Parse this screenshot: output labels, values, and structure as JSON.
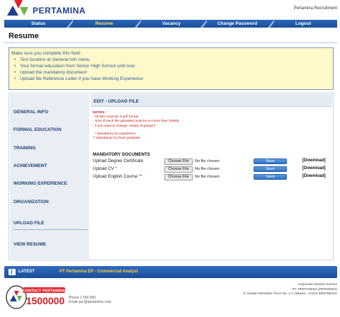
{
  "header": {
    "logo_text": "PERTAMINA",
    "recruitment_label": "Pertamina Recruitment",
    "colors": {
      "brand_blue": "#1e3f8a",
      "brand_red": "#e12229",
      "brand_green": "#6bb644"
    }
  },
  "nav": {
    "items": [
      {
        "label": "Status"
      },
      {
        "label": "Resume"
      },
      {
        "label": "Vacancy"
      },
      {
        "label": "Change Password"
      },
      {
        "label": "Logout"
      }
    ],
    "active": "Resume"
  },
  "page": {
    "title": "Resume"
  },
  "notice": {
    "title": "Make sure you complete this field:",
    "item1_italic1": "Test location",
    "item1_mid": " at ",
    "item1_italic2": "General info",
    "item1_end": " menu",
    "item2": "Your formal education from Senior High School until now",
    "item3": "Upload the mandatory document",
    "item4_start": "Upload file ",
    "item4_italic": "Reference Letter",
    "item4_end": " if you have Working Experience"
  },
  "sidebar": {
    "items": [
      {
        "label": "GENERAL INFO"
      },
      {
        "label": "FORMAL EDUCATION"
      },
      {
        "label": "TRAINING"
      },
      {
        "label": "ACHIEVEMENT"
      },
      {
        "label": "WORKING EXPERIENCE"
      },
      {
        "label": "ORGANIZATION"
      },
      {
        "label": "UPLOAD FILE"
      },
      {
        "label": "VIEW RESUME"
      }
    ]
  },
  "content": {
    "heading": "EDIT - UPLOAD FILE",
    "notes": {
      "title": "NOTES :",
      "l1": "- All files must be in pdf format",
      "l2": "- Size of each file uploaded must be no more than 200KB",
      "l3": "- If you want to change, simply reupload it.",
      "l4": "* Mandatory for experience",
      "l5": "** Mandatory for fresh graduate"
    },
    "mandatory_heading": "MANDATORY DOCUMENTS",
    "uploads": [
      {
        "label": "Upload Degree Certificate",
        "req": "",
        "button": "Choose File",
        "status": "No file chosen",
        "save": "Save",
        "download": "[Download]"
      },
      {
        "label": "Upload CV ",
        "req": "*",
        "button": "Choose File",
        "status": "No file chosen",
        "save": "Save",
        "download": "[Download]"
      },
      {
        "label": "Upload English Course ",
        "req": "**",
        "button": "Choose File",
        "status": "No file chosen",
        "save": "Save",
        "download": "[Download]"
      }
    ]
  },
  "latest": {
    "label": "LATEST",
    "text": "PT Pertamina EP - Commercial Analyst"
  },
  "footer": {
    "contact_label": "CONTACT PERTAMINA",
    "contact_number": "1500000",
    "phone": "Phone 1 500 000",
    "email": "Email pcc@pertamina.com",
    "corp_name": "Corporate Shared Service",
    "company": "PT. PERTAMINA (PERSERO)",
    "address": "Jl. Medan Merdeka Timur No. 1 A Jakarta - 10110 INDONESIA"
  }
}
